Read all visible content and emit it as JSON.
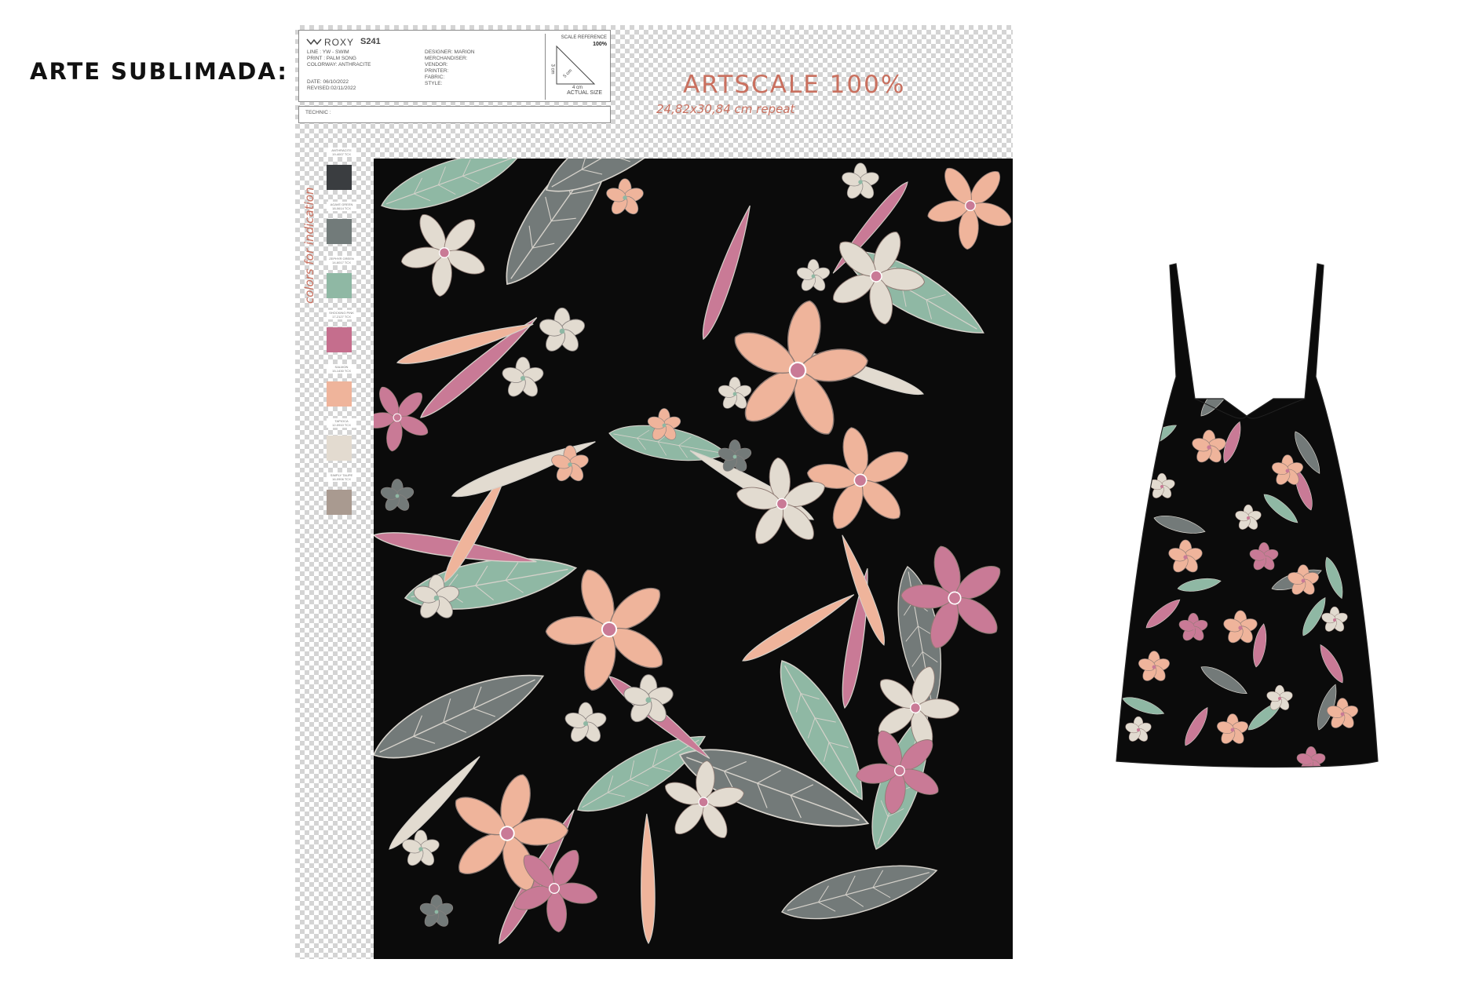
{
  "heading": "ARTE SUBLIMADA:",
  "tech_card": {
    "brand": "ROXY",
    "season": "S241",
    "left_lines": [
      "LINE : YW - SWIM",
      "PRINT : PALM SONG",
      "COLORWAY: ANTHRACITE"
    ],
    "date_lines": [
      "DATE: 06/10/2022",
      "REVISED:02/11/2022"
    ],
    "mid_lines": [
      "DESIGNER: MARION",
      "MERCHANDISER:",
      "VENDOR:",
      "PRINTER:",
      "FABRIC:",
      "STYLE:"
    ],
    "scale_reference": "SCALE REFERENCE",
    "scale_percent": "100%",
    "dim_3cm": "3 cm",
    "dim_4cm": "4 cm",
    "dim_5cm": "5 cm",
    "actual_size": "ACTUAL SIZE",
    "technic": "TECHNIC :"
  },
  "artscale": "ARTSCALE 100%",
  "repeat": "24,82x30,84 cm repeat",
  "indication": "colors for indication",
  "swatches": [
    {
      "name": "ANTHRACITE",
      "code": "19-4007 TCX",
      "color": "#3a3d40"
    },
    {
      "name": "AGAVE GREEN",
      "code": "18-0614 TCX",
      "color": "#727b7a"
    },
    {
      "name": "ZEPHYR GREEN",
      "code": "14-6017 TCX",
      "color": "#8fb8a4"
    },
    {
      "name": "SHOCKING PINK",
      "code": "17-2127 TCX",
      "color": "#c56e8d"
    },
    {
      "name": "SALMON",
      "code": "15-1430 TCX",
      "color": "#efb49b"
    },
    {
      "name": "TAPIOCA",
      "code": "12-0910 TCX",
      "color": "#e3dbd0"
    },
    {
      "name": "SIMPLY TAUPE",
      "code": "16-0906 TCX",
      "color": "#a99a90"
    }
  ],
  "palette": {
    "black": "#0b0b0b",
    "green": "#8fb8a4",
    "gray": "#737a79",
    "pink": "#c97a96",
    "peach": "#efb49b",
    "cream": "#e2dbd0",
    "accent": "#c9705f"
  }
}
